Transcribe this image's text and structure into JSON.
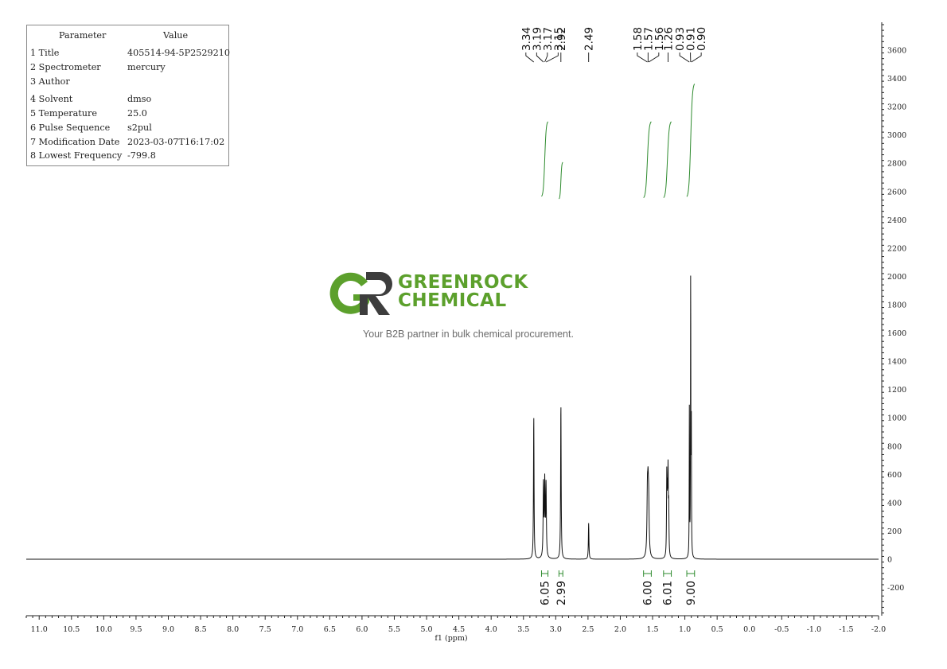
{
  "parameters": {
    "header_param": "Parameter",
    "header_value": "Value",
    "rows": [
      {
        "key": "1 Title",
        "value": "405514-94-5P2529210"
      },
      {
        "key": "2 Spectrometer",
        "value": "mercury"
      },
      {
        "key": "3 Author",
        "value": ""
      },
      {
        "key": "4 Solvent",
        "value": "dmso"
      },
      {
        "key": "5 Temperature",
        "value": "25.0"
      },
      {
        "key": "6 Pulse Sequence",
        "value": "s2pul"
      },
      {
        "key": "7 Modification Date",
        "value": "2023-03-07T16:17:02"
      },
      {
        "key": "8 Lowest Frequency",
        "value": "-799.8"
      }
    ]
  },
  "watermark": {
    "logo_letters": "GR",
    "brand_line1": "GREENROCK",
    "brand_line2": "CHEMICAL",
    "tagline": "Your B2B partner in bulk chemical procurement.",
    "brand_color": "#5ca02c",
    "brand_dark": "#3d3d3d"
  },
  "chart_data": {
    "type": "line",
    "xlabel": "f1 (ppm)",
    "x_reversed": true,
    "xlim": [
      11.2,
      -2.0
    ],
    "ylim": [
      -390,
      3820
    ],
    "x_ticks": [
      {
        "value": 11.0,
        "label": "11.0"
      },
      {
        "value": 10.5,
        "label": "10.5"
      },
      {
        "value": 10.0,
        "label": "10.0"
      },
      {
        "value": 9.5,
        "label": "9.5"
      },
      {
        "value": 9.0,
        "label": "9.0"
      },
      {
        "value": 8.5,
        "label": "8.5"
      },
      {
        "value": 8.0,
        "label": "8.0"
      },
      {
        "value": 7.5,
        "label": "7.5"
      },
      {
        "value": 7.0,
        "label": "7.0"
      },
      {
        "value": 6.5,
        "label": "6.5"
      },
      {
        "value": 6.0,
        "label": "6.0"
      },
      {
        "value": 5.5,
        "label": "5.5"
      },
      {
        "value": 5.0,
        "label": "5.0"
      },
      {
        "value": 4.5,
        "label": "4.5"
      },
      {
        "value": 4.0,
        "label": "4.0"
      },
      {
        "value": 3.5,
        "label": "3.5"
      },
      {
        "value": 3.0,
        "label": "3.0"
      },
      {
        "value": 2.5,
        "label": "2.5"
      },
      {
        "value": 2.0,
        "label": "2.0"
      },
      {
        "value": 1.5,
        "label": "1.5"
      },
      {
        "value": 1.0,
        "label": "1.0"
      },
      {
        "value": 0.5,
        "label": "0.5"
      },
      {
        "value": 0.0,
        "label": "0.0"
      },
      {
        "value": -0.5,
        "label": "-0.5"
      },
      {
        "value": -1.0,
        "label": "-1.0"
      },
      {
        "value": -1.5,
        "label": "-1.5"
      },
      {
        "value": -2.0,
        "label": "-2.0"
      }
    ],
    "y_ticks": [
      {
        "value": 3600,
        "label": "3600"
      },
      {
        "value": 3400,
        "label": "3400"
      },
      {
        "value": 3200,
        "label": "3200"
      },
      {
        "value": 3000,
        "label": "3000"
      },
      {
        "value": 2800,
        "label": "2800"
      },
      {
        "value": 2600,
        "label": "2600"
      },
      {
        "value": 2400,
        "label": "2400"
      },
      {
        "value": 2200,
        "label": "2200"
      },
      {
        "value": 2000,
        "label": "2000"
      },
      {
        "value": 1800,
        "label": "1800"
      },
      {
        "value": 1600,
        "label": "1600"
      },
      {
        "value": 1400,
        "label": "1400"
      },
      {
        "value": 1200,
        "label": "1200"
      },
      {
        "value": 1000,
        "label": "1000"
      },
      {
        "value": 800,
        "label": "800"
      },
      {
        "value": 600,
        "label": "600"
      },
      {
        "value": 400,
        "label": "400"
      },
      {
        "value": 200,
        "label": "200"
      },
      {
        "value": 0,
        "label": "0"
      },
      {
        "value": -200,
        "label": "-200"
      }
    ],
    "peaks": [
      {
        "ppm": 3.34,
        "height": 1010,
        "width": 0.01
      },
      {
        "ppm": 3.19,
        "height": 510,
        "width": 0.012
      },
      {
        "ppm": 3.17,
        "height": 520,
        "width": 0.012
      },
      {
        "ppm": 3.15,
        "height": 505,
        "width": 0.012
      },
      {
        "ppm": 2.92,
        "height": 1100,
        "width": 0.01
      },
      {
        "ppm": 2.49,
        "height": 255,
        "width": 0.01
      },
      {
        "ppm": 1.58,
        "height": 400,
        "width": 0.016
      },
      {
        "ppm": 1.57,
        "height": 370,
        "width": 0.016
      },
      {
        "ppm": 1.56,
        "height": 330,
        "width": 0.016
      },
      {
        "ppm": 1.28,
        "height": 560,
        "width": 0.009
      },
      {
        "ppm": 1.27,
        "height": 380,
        "width": 0.009
      },
      {
        "ppm": 1.26,
        "height": 560,
        "width": 0.009
      },
      {
        "ppm": 1.25,
        "height": 330,
        "width": 0.009
      },
      {
        "ppm": 0.93,
        "height": 1060,
        "width": 0.006
      },
      {
        "ppm": 0.91,
        "height": 1990,
        "width": 0.006
      },
      {
        "ppm": 0.9,
        "height": 900,
        "width": 0.006
      }
    ],
    "peak_label_groups": [
      {
        "labels": [
          "3.34",
          "3.19",
          "3.17",
          "3.15"
        ],
        "ppm": [
          3.34,
          3.19,
          3.17,
          3.15
        ]
      },
      {
        "labels": [
          "2.92"
        ],
        "ppm": [
          2.92
        ]
      },
      {
        "labels": [
          "2.49"
        ],
        "ppm": [
          2.49
        ]
      },
      {
        "labels": [
          "1.58",
          "1.57",
          "1.56"
        ],
        "ppm": [
          1.58,
          1.57,
          1.56
        ]
      },
      {
        "labels": [
          "1.26"
        ],
        "ppm": [
          1.26
        ]
      },
      {
        "labels": [
          "0.93",
          "0.91",
          "0.90"
        ],
        "ppm": [
          0.93,
          0.91,
          0.9
        ]
      }
    ],
    "integrations": [
      {
        "label": "6.05",
        "from": 3.22,
        "to": 3.12,
        "curve_from": 2560,
        "curve_to": 3100
      },
      {
        "label": "2.99",
        "from": 2.95,
        "to": 2.89,
        "curve_from": 2545,
        "curve_to": 2810
      },
      {
        "label": "6.00",
        "from": 1.64,
        "to": 1.52,
        "curve_from": 2550,
        "curve_to": 3100
      },
      {
        "label": "6.01",
        "from": 1.33,
        "to": 1.21,
        "curve_from": 2550,
        "curve_to": 3100
      },
      {
        "label": "9.00",
        "from": 0.97,
        "to": 0.85,
        "curve_from": 2555,
        "curve_to": 3370
      }
    ],
    "integral_color": "#2e8b2e",
    "line_color": "#111111"
  }
}
